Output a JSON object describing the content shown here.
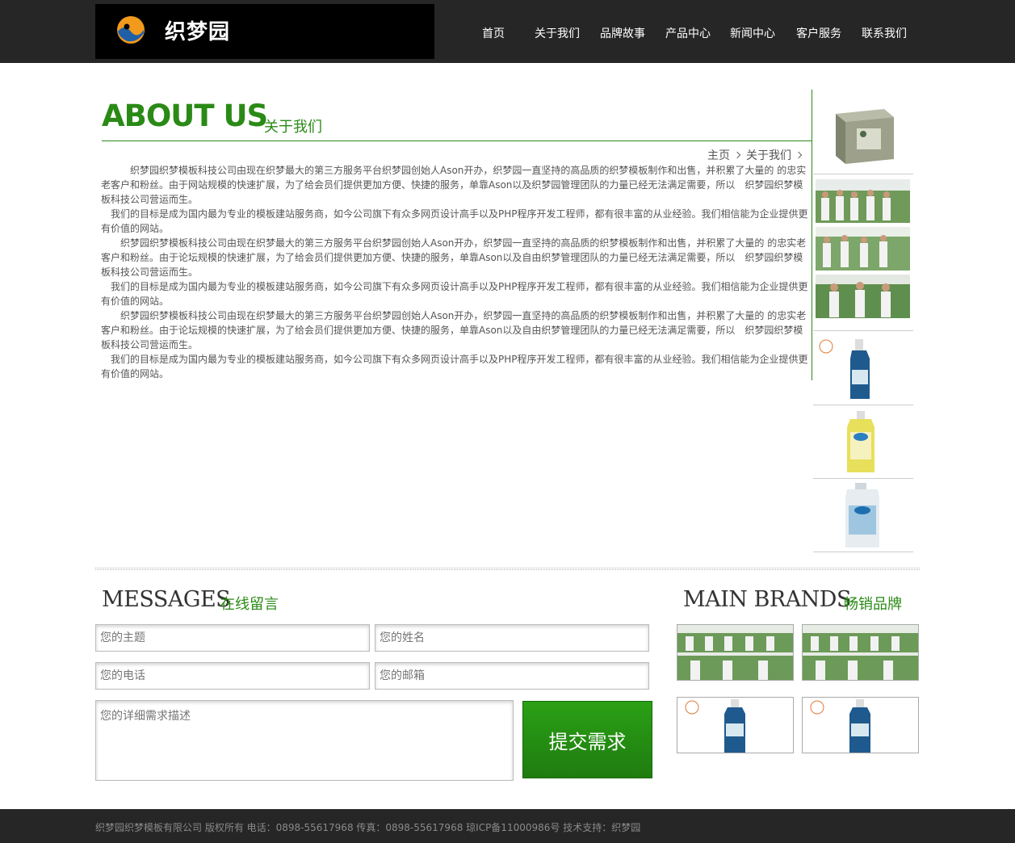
{
  "header": {
    "logo_text": "织梦园",
    "nav": [
      "首页",
      "关于我们",
      "品牌故事",
      "产品中心",
      "新闻中心",
      "客户服务",
      "联系我们"
    ]
  },
  "about": {
    "title_en": "ABOUT US",
    "title_cn": "关于我们",
    "breadcrumb": [
      "主页",
      "关于我们"
    ],
    "paragraphs": [
      "　　　织梦园织梦模板科技公司由现在织梦最大的第三方服务平台织梦园创始人Ason开办，织梦园一直坚持的高品质的织梦模板制作和出售，并积累了大量的 的忠实老客户和粉丝。由于网站规模的快速扩展，为了给会员们提供更加方便、快捷的服务，单靠Ason以及织梦园管理团队的力量已经无法满足需要，所以　织梦园织梦模板科技公司营运而生。",
      "　我们的目标是成为国内最为专业的模板建站服务商，如今公司旗下有众多网页设计高手以及PHP程序开发工程师，都有很丰富的从业经验。我们相信能为企业提供更有价值的网站。",
      "　　织梦园织梦模板科技公司由现在织梦最大的第三方服务平台织梦园创始人Ason开办，织梦园一直坚持的高品质的织梦模板制作和出售，并积累了大量的 的忠实老客户和粉丝。由于论坛规模的快速扩展，为了给会员们提供更加方便、快捷的服务，单靠Ason以及自由织梦管理团队的力量已经无法满足需要，所以　织梦园织梦模板科技公司营运而生。",
      "　我们的目标是成为国内最为专业的模板建站服务商，如今公司旗下有众多网页设计高手以及PHP程序开发工程师，都有很丰富的从业经验。我们相信能为企业提供更有价值的网站。",
      "　　织梦园织梦模板科技公司由现在织梦最大的第三方服务平台织梦园创始人Ason开办，织梦园一直坚持的高品质的织梦模板制作和出售，并积累了大量的 的忠实老客户和粉丝。由于论坛规模的快速扩展，为了给会员们提供更加方便、快捷的服务，单靠Ason以及自由织梦管理团队的力量已经无法满足需要，所以　织梦园织梦模板科技公司营运而生。",
      "　我们的目标是成为国内最为专业的模板建站服务商，如今公司旗下有众多网页设计高手以及PHP程序开发工程师，都有很丰富的从业经验。我们相信能为企业提供更有价值的网站。"
    ]
  },
  "messages": {
    "title_en": "MESSAGES",
    "title_cn": "在线留言",
    "subject_placeholder": "您的主题",
    "name_placeholder": "您的姓名",
    "phone_placeholder": "您的电话",
    "email_placeholder": "您的邮箱",
    "detail_placeholder": "您的详细需求描述",
    "submit_label": "提交需求"
  },
  "brands": {
    "title_en": "MAIN BRANDS",
    "title_cn": "畅销品牌"
  },
  "footer": {
    "text": "织梦园织梦模板有限公司 版权所有 电话：0898-55617968 传真：0898-55617968 琼ICP备11000986号 技术支持：织梦园"
  },
  "colors": {
    "accent_green": "#2a8a16",
    "header_bg": "#262626"
  }
}
